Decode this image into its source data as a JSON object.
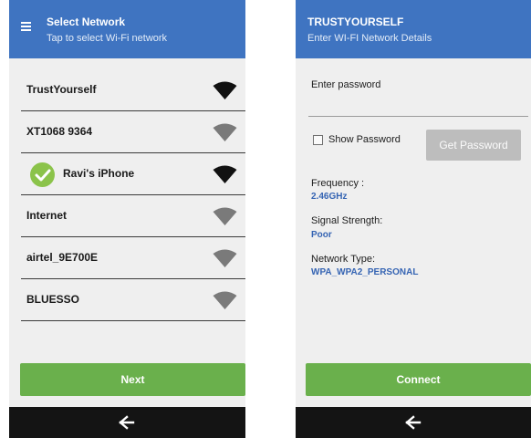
{
  "left_screen": {
    "header": {
      "title": "Select Network",
      "subtitle": "Tap to select Wi-Fi network"
    },
    "networks": [
      {
        "name": "TrustYourself",
        "signal": "strong",
        "connected": false
      },
      {
        "name": "XT1068 9364",
        "signal": "weak",
        "connected": false
      },
      {
        "name": "Ravi's iPhone",
        "signal": "strong",
        "connected": true
      },
      {
        "name": "Internet",
        "signal": "weak",
        "connected": false
      },
      {
        "name": "airtel_9E700E",
        "signal": "weak",
        "connected": false
      },
      {
        "name": "BLUESSO",
        "signal": "weak",
        "connected": false
      }
    ],
    "next_label": "Next"
  },
  "right_screen": {
    "header": {
      "title": "TRUSTYOURSELF",
      "subtitle": "Enter WI-FI Network Details"
    },
    "password": {
      "label": "Enter password",
      "value": "",
      "placeholder": ""
    },
    "show_password_label": "Show Password",
    "show_password_checked": false,
    "get_password_label": "Get Password",
    "details": [
      {
        "label": "Frequency :",
        "value": "2.46GHz"
      },
      {
        "label": "Signal Strength:",
        "value": "Poor"
      },
      {
        "label": "Network Type:",
        "value": "WPA_WPA2_PERSONAL"
      }
    ],
    "connect_label": "Connect"
  },
  "icons": {
    "menu": "hamburger-menu-icon",
    "wifi": "wifi-signal-icon",
    "connected": "check-circle-icon",
    "back": "back-arrow-icon"
  },
  "colors": {
    "app_bar": "#3f74c1",
    "primary_button": "#6ab04c",
    "disabled_button": "#bdbdbd",
    "value_text": "#3564b3",
    "signal_strong": "#111111",
    "signal_weak": "#7a7a7a",
    "check": "#8bc34a",
    "nav_bar": "#141414"
  }
}
